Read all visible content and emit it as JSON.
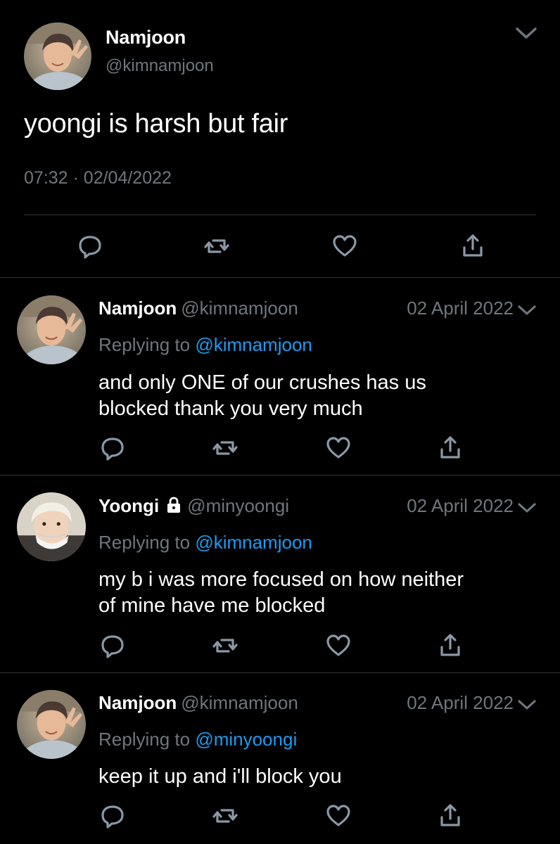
{
  "main_tweet": {
    "author_name": "Namjoon",
    "author_handle": "@kimnamjoon",
    "text": "yoongi is harsh but fair",
    "time": "07:32",
    "separator": "·",
    "date": "02/04/2022",
    "actions": [
      "reply-icon",
      "retweet-icon",
      "like-icon",
      "share-icon"
    ]
  },
  "replies": [
    {
      "name": "Namjoon",
      "handle": "@kimnamjoon",
      "date": "02 April 2022",
      "replying_prefix": "Replying to",
      "replying_to": "@kimnamjoon",
      "text_lines": [
        "and only ONE of our crushes has us",
        "blocked thank you very much"
      ]
    },
    {
      "name": "Yoongi",
      "handle": "@minyoongi",
      "protected_icon": "lock-icon",
      "date": "02 April 2022",
      "replying_prefix": "Replying to",
      "replying_to": "@kimnamjoon",
      "text_lines": [
        "my b i was more focused on how neither",
        "of mine have me blocked"
      ]
    },
    {
      "name": "Namjoon",
      "handle": "@kimnamjoon",
      "date": "02 April 2022",
      "replying_prefix": "Replying to",
      "replying_to": "@minyoongi",
      "text_lines": [
        "keep it up and i'll block you"
      ]
    }
  ],
  "colors": {
    "background": "#000000",
    "primary_text": "#ffffff",
    "secondary_text": "#6e767d",
    "link": "#1d9bf0",
    "divider": "#2f3336"
  }
}
